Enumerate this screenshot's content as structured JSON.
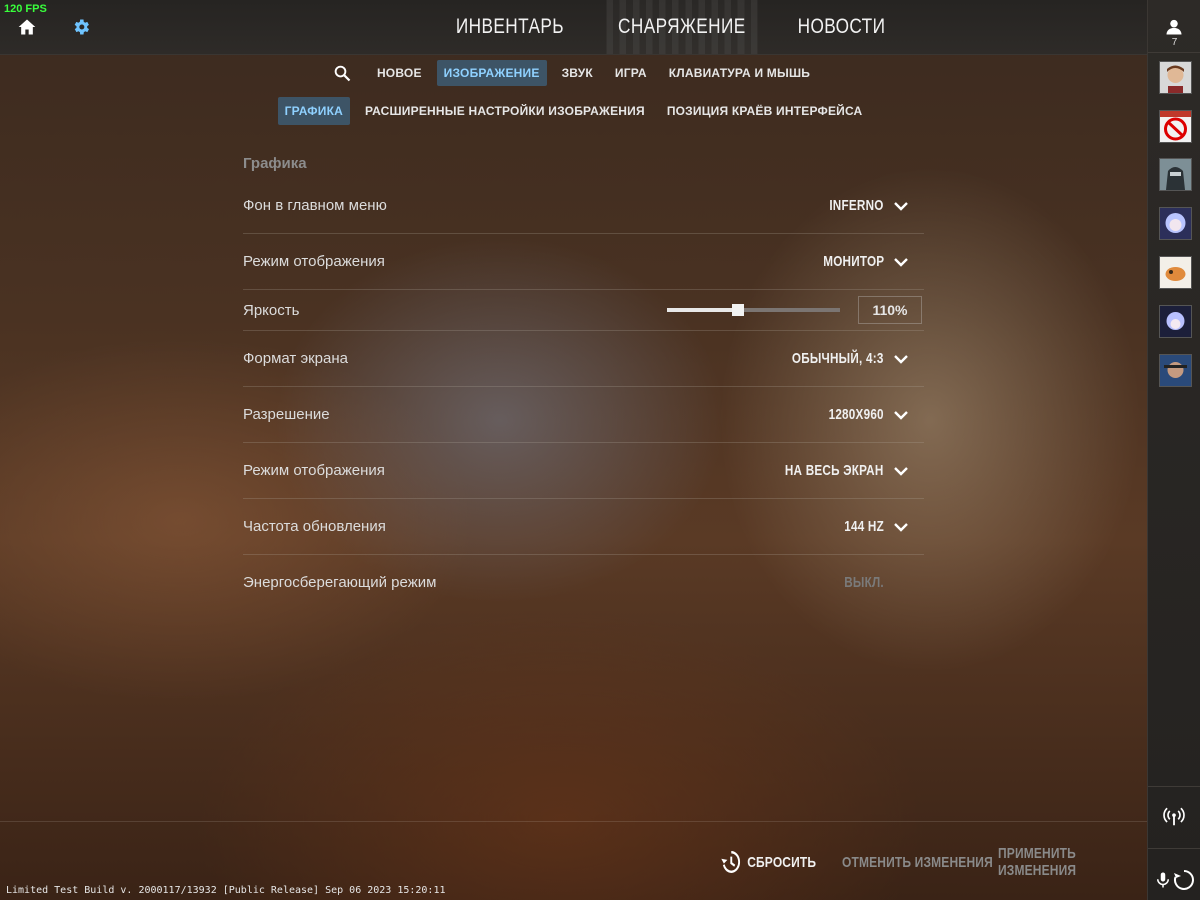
{
  "fps": "120 FPS",
  "main_nav": [
    "ИНВЕНТАРЬ",
    "СНАРЯЖЕНИЕ",
    "НОВОСТИ"
  ],
  "friends_count": "7",
  "tabs": [
    "НОВОЕ",
    "ИЗОБРАЖЕНИЕ",
    "ЗВУК",
    "ИГРА",
    "КЛАВИАТУРА И МЫШЬ"
  ],
  "subtabs": [
    "ГРАФИКА",
    "РАСШИРЕННЫЕ НАСТРОЙКИ ИЗОБРАЖЕНИЯ",
    "ПОЗИЦИЯ КРАЁВ ИНТЕРФЕЙСА"
  ],
  "section_title": "Графика",
  "settings": {
    "menu_bg": {
      "label": "Фон в главном меню",
      "value": "INFERNO"
    },
    "display_mode": {
      "label": "Режим отображения",
      "value": "МОНИТОР"
    },
    "brightness": {
      "label": "Яркость",
      "value": "110%",
      "level": 0.41
    },
    "aspect": {
      "label": "Формат экрана",
      "value": "ОБЫЧНЫЙ, 4:3"
    },
    "resolution": {
      "label": "Разрешение",
      "value": "1280X960"
    },
    "window_mode": {
      "label": "Режим отображения",
      "value": "НА ВЕСЬ ЭКРАН"
    },
    "refresh": {
      "label": "Частота обновления",
      "value": "144 HZ"
    },
    "power_saving": {
      "label": "Энергосберегающий режим",
      "value": "ВЫКЛ."
    }
  },
  "footer": {
    "reset": "СБРОСИТЬ",
    "cancel": "ОТМЕНИТЬ ИЗМЕНЕНИЯ",
    "apply": "ПРИМЕНИТЬ ИЗМЕНЕНИЯ"
  },
  "build_info": "Limited Test Build v. 2000117/13932 [Public Release] Sep 06 2023 15:20:11",
  "colors": {
    "accent_tab_bg": "#3d5466",
    "accent_tab_text": "#8fd1ff",
    "fps_text": "#39ff3c"
  }
}
